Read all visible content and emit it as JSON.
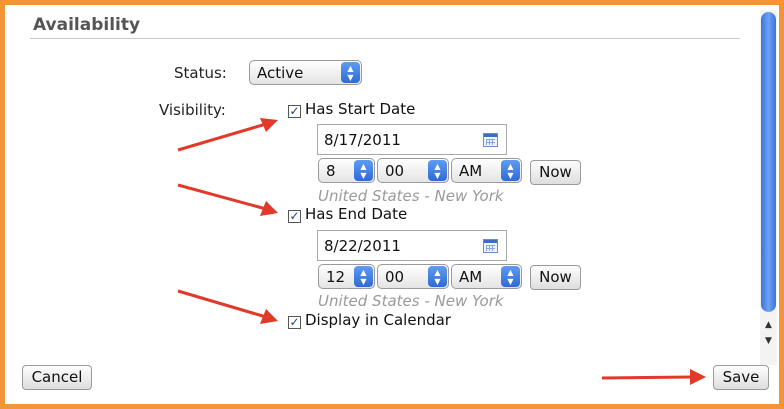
{
  "section": {
    "title": "Availability"
  },
  "status": {
    "label": "Status:",
    "value": "Active"
  },
  "visibility": {
    "label": "Visibility:",
    "start": {
      "checkbox_label": "Has Start Date",
      "checked": true,
      "date": "8/17/2011",
      "hour": "8",
      "minute": "00",
      "ampm": "AM",
      "now_label": "Now",
      "timezone": "United States - New York"
    },
    "end": {
      "checkbox_label": "Has End Date",
      "checked": true,
      "date": "8/22/2011",
      "hour": "12",
      "minute": "00",
      "ampm": "AM",
      "now_label": "Now",
      "timezone": "United States - New York"
    },
    "display_in_calendar": {
      "checkbox_label": "Display in Calendar",
      "checked": true
    }
  },
  "footer": {
    "cancel_label": "Cancel",
    "save_label": "Save"
  },
  "colors": {
    "frame": "#f4943a",
    "annotation_arrow": "#e03a2a",
    "select_accent": "#3a7ae0"
  },
  "icons": {
    "checkmark": "checkmark-icon",
    "calendar": "calendar-icon",
    "stepper": "up-down-stepper-icon"
  }
}
